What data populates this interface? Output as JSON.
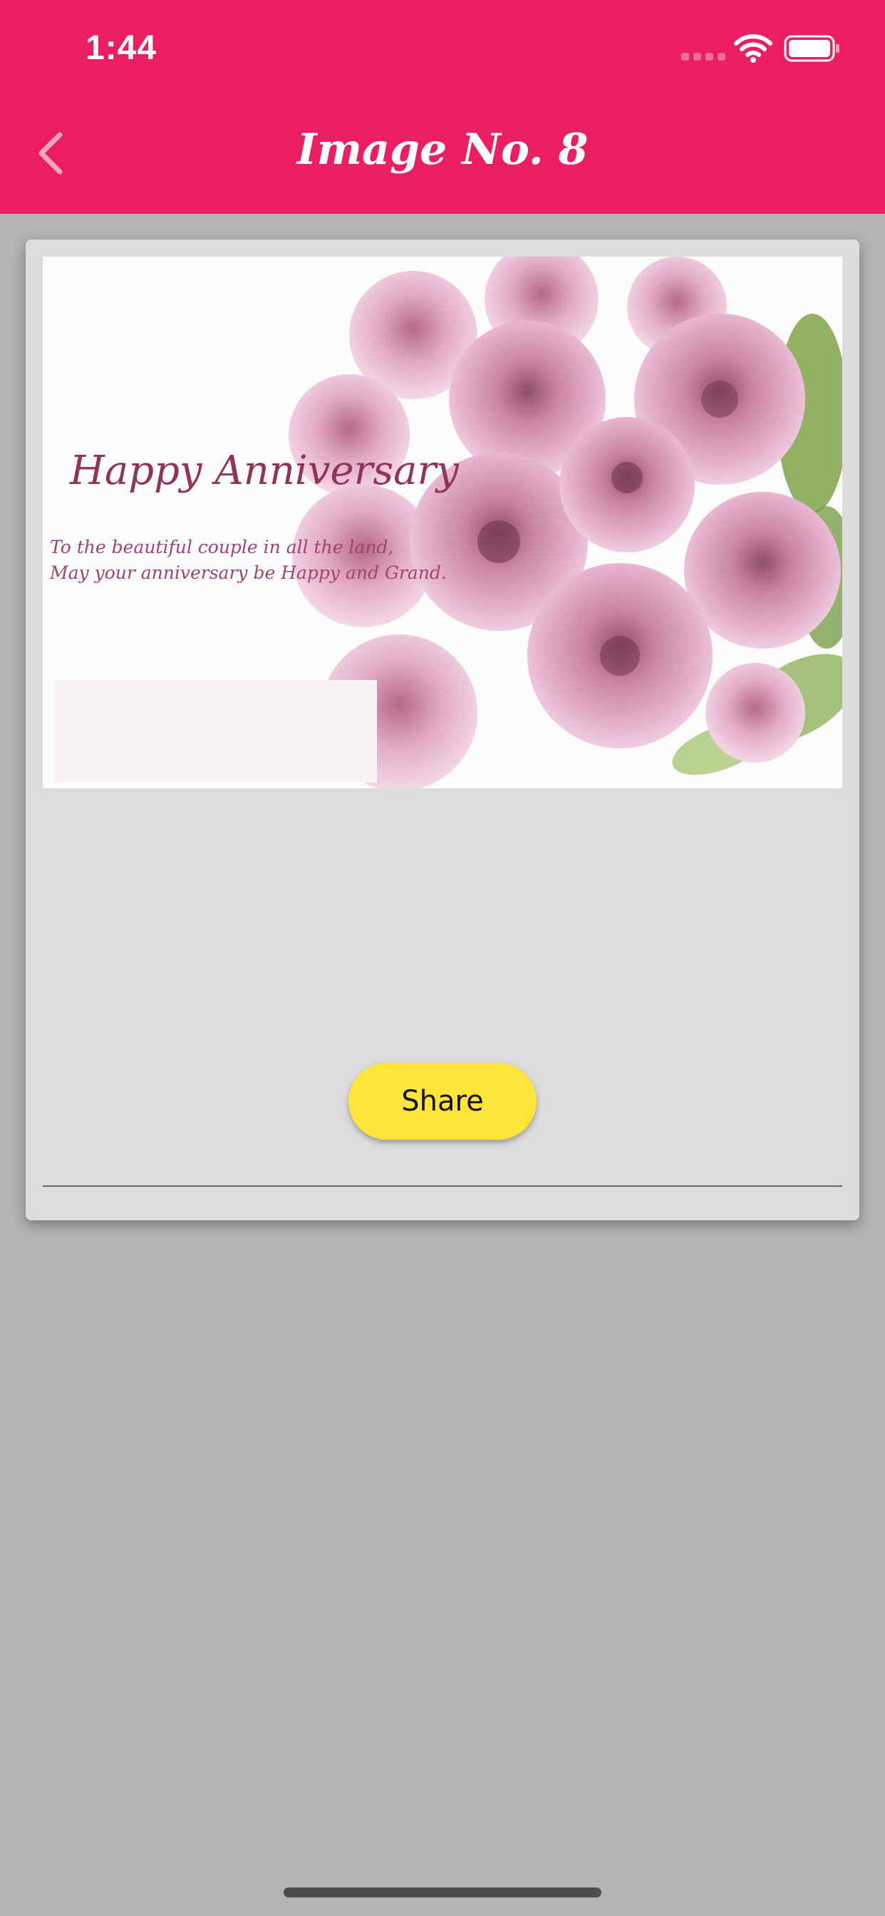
{
  "status_bar": {
    "time": "1:44"
  },
  "header": {
    "title": "Image No. 8"
  },
  "card_image": {
    "title": "Happy Anniversary",
    "message_lines": [
      "To the beautiful couple in all the land,",
      "May your anniversary be Happy and Grand."
    ]
  },
  "actions": {
    "share_label": "Share"
  },
  "colors": {
    "header": "#eb1e63",
    "share_button": "#ffe539",
    "background": "#b3b3b3"
  }
}
